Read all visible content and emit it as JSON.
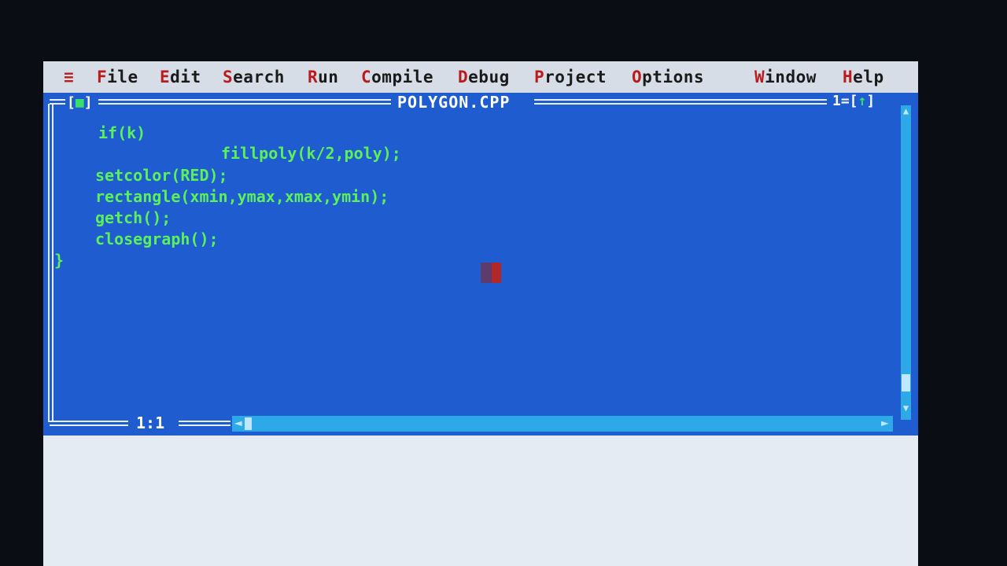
{
  "menu": {
    "system": "≡",
    "items": [
      {
        "hot": "F",
        "rest": "ile"
      },
      {
        "hot": "E",
        "rest": "dit"
      },
      {
        "hot": "S",
        "rest": "earch"
      },
      {
        "hot": "R",
        "rest": "un"
      },
      {
        "hot": "C",
        "rest": "ompile"
      },
      {
        "hot": "D",
        "rest": "ebug"
      },
      {
        "hot": "P",
        "rest": "roject"
      },
      {
        "hot": "O",
        "rest": "ptions"
      },
      {
        "hot": "W",
        "rest": "indow"
      },
      {
        "hot": "H",
        "rest": "elp"
      }
    ]
  },
  "editor": {
    "close_box_left": "[",
    "close_box_mark": "■",
    "close_box_right": "]",
    "title": "POLYGON.CPP",
    "window_number": "1=[",
    "zoom_arrow": "↑",
    "zoom_close": "]",
    "code_lines": [
      "if(k)",
      "fillpoly(k/2,poly);",
      "setcolor(RED);",
      "rectangle(xmin,ymax,xmax,ymin);",
      "getch();",
      "closegraph();",
      "}"
    ],
    "cursor_position": "1:1"
  },
  "icons": {
    "scroll_up": "▲",
    "scroll_down": "▼",
    "scroll_left": "◄",
    "scroll_right": "►"
  },
  "colors": {
    "editor_bg": "#1f5ccf",
    "code_text": "#5cf05c",
    "menu_bg": "#d6dde6",
    "hotkey": "#b81c1c",
    "scrollbar": "#2ea9e8"
  }
}
